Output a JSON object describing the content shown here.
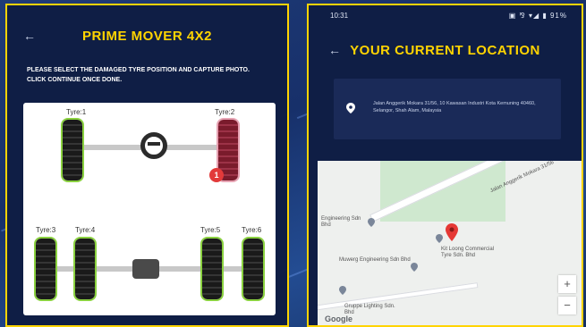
{
  "colors": {
    "accent": "#ffd400",
    "panel_bg": "#0f1e45",
    "damaged_tyre": "#7a1b2c",
    "selected_glow": "#8ad13f",
    "badge_red": "#e23a3a"
  },
  "left_screen": {
    "back_icon": "back-arrow-icon",
    "title": "PRIME MOVER 4X2",
    "instruction": "PLEASE SELECT THE DAMAGED TYRE POSITION AND CAPTURE PHOTO. CLICK CONTINUE ONCE DONE.",
    "tyres": [
      {
        "label": "Tyre:1",
        "status": "ok"
      },
      {
        "label": "Tyre:2",
        "status": "damaged",
        "badge": "1"
      },
      {
        "label": "Tyre:3",
        "status": "ok"
      },
      {
        "label": "Tyre:4",
        "status": "ok"
      },
      {
        "label": "Tyre:5",
        "status": "ok"
      },
      {
        "label": "Tyre:6",
        "status": "ok"
      }
    ]
  },
  "right_screen": {
    "status_bar": {
      "time": "10:31",
      "icons": "▣ ⅋ ▾◢ ▮ 91%"
    },
    "back_icon": "back-arrow-icon",
    "title": "YOUR CURRENT LOCATION",
    "address": "Jalan Anggerik Mokara 31/56, 10 Kawasan Industri Kota Kemuning 40460, Selangor, Shah Alam, Malaysia",
    "map": {
      "places": [
        {
          "name": "Engineering Sdn Bhd"
        },
        {
          "name": "Kit Loong Commercial Tyre Sdn. Bhd"
        },
        {
          "name": "Muwerg Engineering Sdn Bhd"
        },
        {
          "name": "Gruppe Lighting Sdn. Bhd"
        }
      ],
      "road_label": "Jalan Anggerik Mokara 31/56",
      "zoom_in": "+",
      "zoom_out": "−",
      "logo": "Google"
    }
  }
}
